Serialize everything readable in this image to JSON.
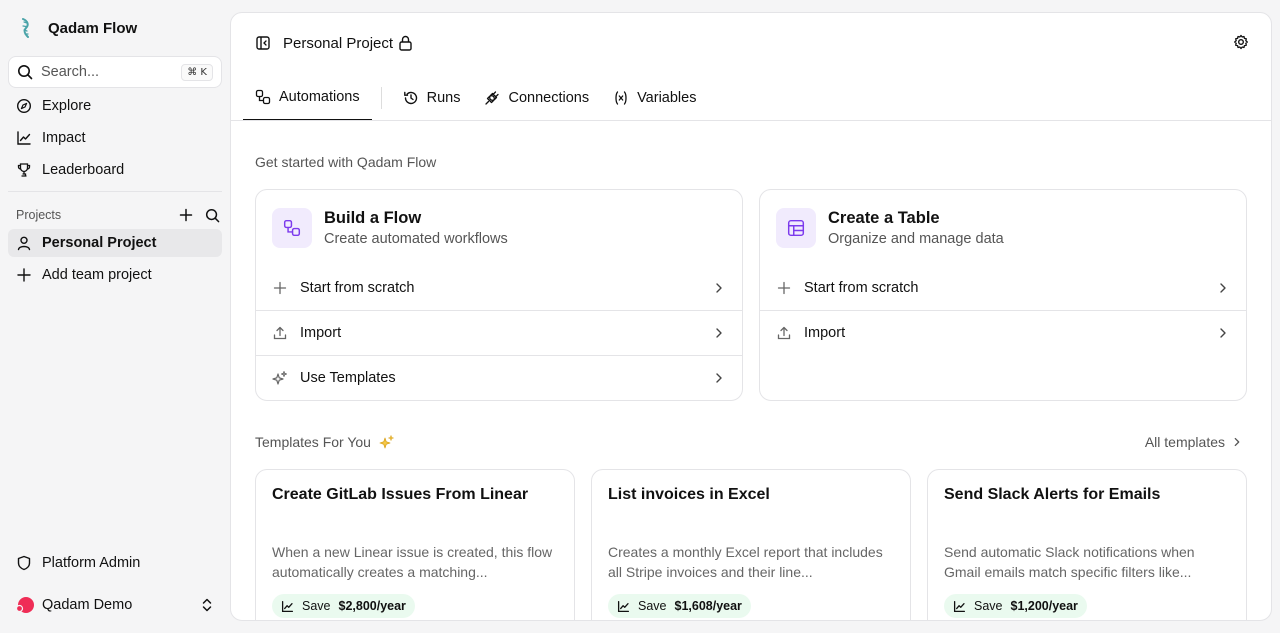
{
  "brand": {
    "name": "Qadam Flow"
  },
  "search": {
    "placeholder": "Search...",
    "shortcut": "⌘ K"
  },
  "nav": [
    {
      "label": "Explore",
      "icon": "compass-icon"
    },
    {
      "label": "Impact",
      "icon": "chart-line-icon"
    },
    {
      "label": "Leaderboard",
      "icon": "trophy-icon"
    }
  ],
  "projects": {
    "label": "Projects",
    "items": [
      {
        "label": "Personal Project",
        "icon": "user-icon",
        "active": true
      },
      {
        "label": "Add team project",
        "icon": "plus-icon",
        "active": false
      }
    ]
  },
  "footer": {
    "admin_label": "Platform Admin",
    "user_name": "Qadam Demo"
  },
  "header": {
    "title": "Personal Project",
    "locked": true
  },
  "tabs": [
    {
      "label": "Automations",
      "active": true
    },
    {
      "label": "Runs",
      "active": false
    },
    {
      "label": "Connections",
      "active": false
    },
    {
      "label": "Variables",
      "active": false
    }
  ],
  "get_started": {
    "title": "Get started with Qadam Flow",
    "cards": [
      {
        "title": "Build a Flow",
        "subtitle": "Create automated workflows",
        "actions": [
          "Start from scratch",
          "Import",
          "Use Templates"
        ]
      },
      {
        "title": "Create a Table",
        "subtitle": "Organize and manage data",
        "actions": [
          "Start from scratch",
          "Import"
        ]
      }
    ]
  },
  "templates": {
    "title": "Templates For You",
    "all_label": "All templates",
    "items": [
      {
        "title": "Create GitLab Issues From Linear",
        "description": "When a new Linear issue is created, this flow automatically creates a matching...",
        "save_prefix": "Save",
        "save_value": "$2,800/year"
      },
      {
        "title": "List invoices in Excel",
        "description": "Creates a monthly Excel report that includes all Stripe invoices and their line...",
        "save_prefix": "Save",
        "save_value": "$1,608/year"
      },
      {
        "title": "Send Slack Alerts for Emails",
        "description": "Send automatic Slack notifications when Gmail emails match specific filters like...",
        "save_prefix": "Save",
        "save_value": "$1,200/year"
      }
    ]
  },
  "colors": {
    "accent_purple": "#7c3aed",
    "badge_bg": "#f1ebfd",
    "save_bg": "#eafaef",
    "avatar": "#ef2d56"
  }
}
